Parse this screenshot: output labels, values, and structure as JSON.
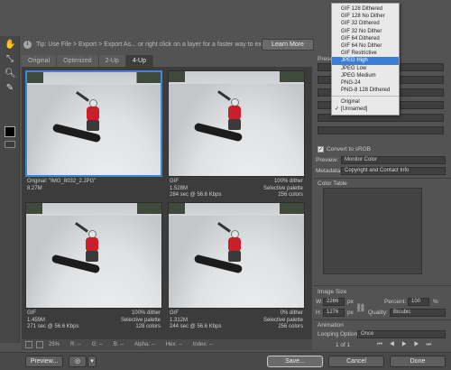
{
  "tip": {
    "text": "Tip: Use File > Export > Export As... or right click on a layer for a faster way to export assets",
    "learn_more": "Learn More"
  },
  "tabs": [
    "Original",
    "Optimized",
    "2-Up",
    "4-Up"
  ],
  "panes": [
    {
      "l1": "Original: \"IMG_8032_2.JPG\"",
      "l2": "8.27M",
      "l3": "",
      "r1": "",
      "r2": "",
      "r3": ""
    },
    {
      "l1": "GIF",
      "l2": "1.528M",
      "l3": "284 sec @ 56.6 Kbps",
      "r1": "100% dither",
      "r2": "Selective palette",
      "r3": "256 colors"
    },
    {
      "l1": "GIF",
      "l2": "1.459M",
      "l3": "271 sec @ 56.6 Kbps",
      "r1": "100% dither",
      "r2": "Selective palette",
      "r3": "128 colors"
    },
    {
      "l1": "GIF",
      "l2": "1.312M",
      "l3": "244 sec @ 56.6 Kbps",
      "r1": "0% dither",
      "r2": "Selective palette",
      "r3": "256 colors"
    }
  ],
  "status": {
    "zoom": "25%",
    "r": "R: --",
    "g": "G: --",
    "b": "B: --",
    "alpha": "Alpha: --",
    "hex": "Hex: --",
    "index": "Index: --"
  },
  "bottom": {
    "preview": "Preview...",
    "save": "Save...",
    "cancel": "Cancel",
    "done": "Done"
  },
  "right": {
    "preset_label": "Prese",
    "convert_srgb": "Convert to sRGB",
    "preview_label": "Preview:",
    "preview_value": "Monitor Color",
    "metadata_label": "Metadata:",
    "metadata_value": "Copyright and Contact Info",
    "color_table": "Color Table",
    "image_size": "Image Size",
    "w_label": "W:",
    "w_value": "2266",
    "h_label": "H:",
    "h_value": "1276",
    "px": "px",
    "percent_label": "Percent:",
    "percent_value": "100",
    "percent_unit": "%",
    "quality_label": "Quality:",
    "quality_value": "Bicubic",
    "animation": "Animation",
    "looping_label": "Looping Options:",
    "looping_value": "Once",
    "frame_counter": "1 of 1"
  },
  "dropdown": {
    "items": [
      "GIF 128 Dithered",
      "GIF 128 No Dither",
      "GIF 32 Dithered",
      "GIF 32 No Dither",
      "GIF 64 Dithered",
      "GIF 64 No Dither",
      "GIF Restrictive",
      "JPEG High",
      "JPEG Low",
      "JPEG Medium",
      "PNG-24",
      "PNG-8 128 Dithered"
    ],
    "selected": "JPEG High",
    "extra": [
      "Original",
      "[Unnamed]"
    ],
    "checked": "[Unnamed]"
  },
  "colors": {
    "selection": "#3b88d8",
    "highlight": "#3b7ed8"
  }
}
